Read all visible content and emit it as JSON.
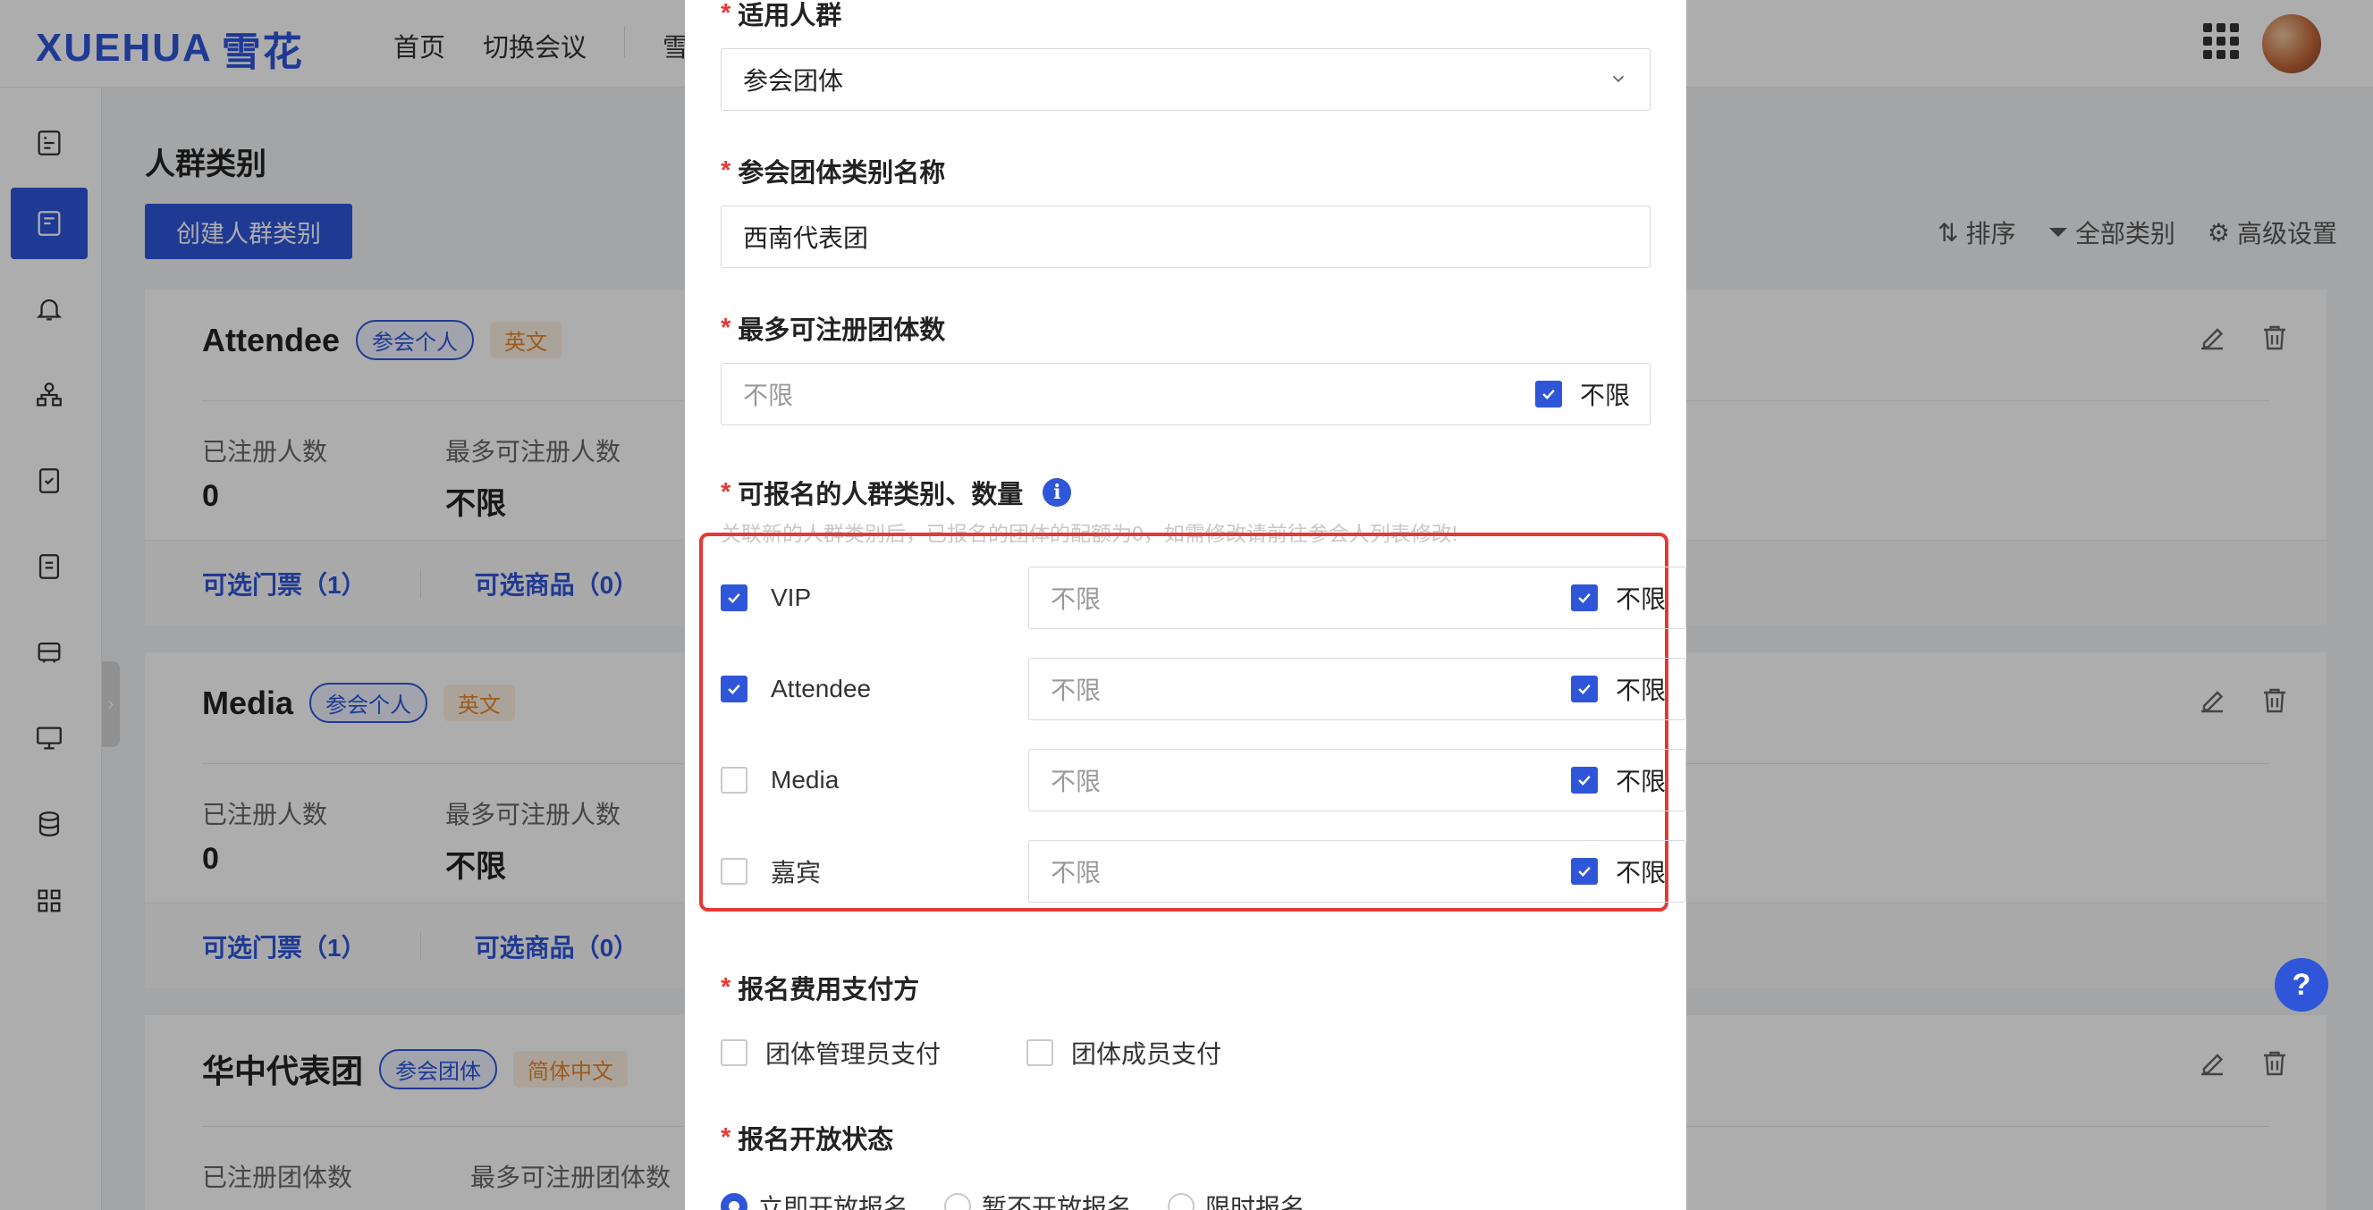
{
  "app": {
    "logo_text": "XUEHUA",
    "logo_cn": "雪花",
    "nav": [
      "首页",
      "切换会议",
      "雪"
    ]
  },
  "page": {
    "title": "人群类别",
    "create_button": "创建人群类别",
    "toolbar": {
      "sort": "排序",
      "all_categories": "全部类别",
      "advanced": "高级设置"
    }
  },
  "cards": [
    {
      "name": "Attendee",
      "type_tag": "参会个人",
      "lang_tag": "英文",
      "stat1_label": "已注册人数",
      "stat1_value": "0",
      "stat2_label": "最多可注册人数",
      "stat2_value": "不限",
      "tickets": "可选门票（1）",
      "goods": "可选商品（0）"
    },
    {
      "name": "Media",
      "type_tag": "参会个人",
      "lang_tag": "英文",
      "stat1_label": "已注册人数",
      "stat1_value": "0",
      "stat2_label": "最多可注册人数",
      "stat2_value": "不限",
      "tickets": "可选门票（1）",
      "goods": "可选商品（0）"
    },
    {
      "name": "华中代表团",
      "type_tag": "参会团体",
      "lang_tag": "简体中文",
      "stat1_label": "已注册团体数",
      "stat2_label": "最多可注册团体数"
    }
  ],
  "modal": {
    "audience_label": "适用人群",
    "audience_value": "参会团体",
    "group_name_label": "参会团体类别名称",
    "group_name_value": "西南代表团",
    "max_groups_label": "最多可注册团体数",
    "max_groups_placeholder": "不限",
    "unlimited_label": "不限",
    "categories_label": "可报名的人群类别、数量",
    "categories_hint": "关联新的人群类别后，已报名的团体的配额为0，如需修改请前往参会人列表修改!",
    "categories": [
      {
        "name": "VIP",
        "checked": true,
        "placeholder": "不限",
        "unlimited": "不限"
      },
      {
        "name": "Attendee",
        "checked": true,
        "placeholder": "不限",
        "unlimited": "不限"
      },
      {
        "name": "Media",
        "checked": false,
        "placeholder": "不限",
        "unlimited": "不限"
      },
      {
        "name": "嘉宾",
        "checked": false,
        "placeholder": "不限",
        "unlimited": "不限"
      }
    ],
    "payer_label": "报名费用支付方",
    "payer_options": [
      "团体管理员支付",
      "团体成员支付"
    ],
    "status_label": "报名开放状态",
    "status_options": [
      "立即开放报名",
      "暂不开放报名",
      "限时报名"
    ]
  },
  "help_label": "?",
  "colors": {
    "primary": "#2f56d9",
    "danger": "#e53935",
    "tag_orange": "#e8862a"
  }
}
